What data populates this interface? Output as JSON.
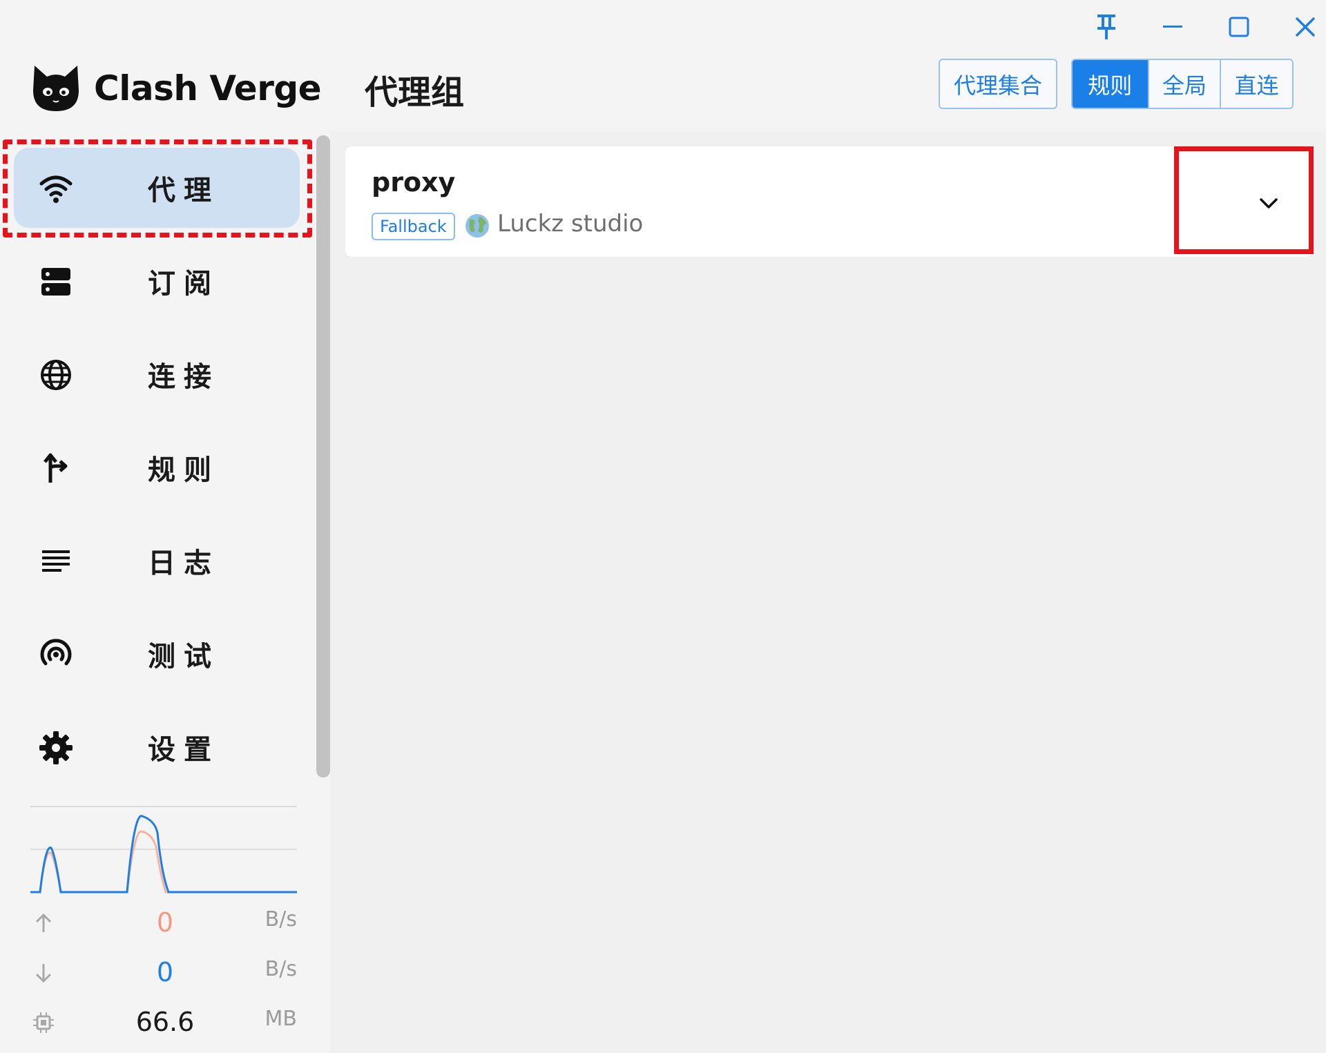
{
  "app": {
    "name": "Clash Verge"
  },
  "sidebar": {
    "items": [
      {
        "label": "代理",
        "icon": "wifi-icon",
        "active": true
      },
      {
        "label": "订阅",
        "icon": "server-icon",
        "active": false
      },
      {
        "label": "连接",
        "icon": "globe-icon",
        "active": false
      },
      {
        "label": "规则",
        "icon": "fork-arrow-icon",
        "active": false
      },
      {
        "label": "日志",
        "icon": "list-lines-icon",
        "active": false
      },
      {
        "label": "测试",
        "icon": "radar-icon",
        "active": false
      },
      {
        "label": "设置",
        "icon": "gear-icon",
        "active": false
      }
    ]
  },
  "traffic": {
    "upload": {
      "value": "0",
      "unit": "B/s",
      "color": "#f39a7e"
    },
    "download": {
      "value": "0",
      "unit": "B/s",
      "color": "#1e7ee4"
    },
    "memory": {
      "value": "66.6",
      "unit": "MB"
    }
  },
  "header": {
    "title": "代理组",
    "proxy_set_button": "代理集合",
    "modes": [
      {
        "label": "规则",
        "active": true
      },
      {
        "label": "全局",
        "active": false
      },
      {
        "label": "直连",
        "active": false
      }
    ]
  },
  "window_controls": [
    "pin-icon",
    "minimize-icon",
    "maximize-icon",
    "close-icon"
  ],
  "groups": [
    {
      "name": "proxy",
      "type": "Fallback",
      "selected": "Luckz studio"
    }
  ],
  "colors": {
    "accent": "#1a7fe6",
    "highlight_dash": "#e4131c",
    "sidebar_active": "#cfe0f3"
  }
}
